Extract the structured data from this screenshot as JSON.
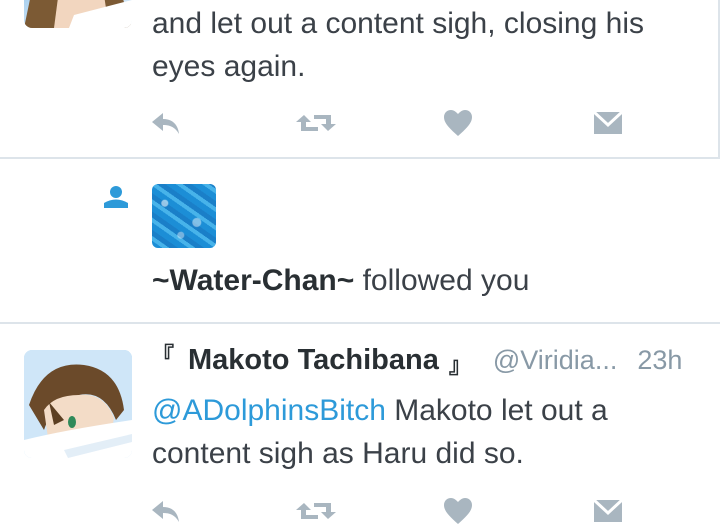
{
  "colors": {
    "accent": "#2d9ad9",
    "icon_gray": "#a9b6c0",
    "text": "#3b4148",
    "muted": "#8899a6",
    "divider": "#dde4ea"
  },
  "tweet_top": {
    "text": "and let out a content sigh, closing his eyes again.",
    "actions": [
      "reply-icon",
      "retweet-icon",
      "like-icon",
      "message-icon"
    ]
  },
  "follow_notification": {
    "icon": "person-icon",
    "name": "~Water-Chan~",
    "action_text": " followed you"
  },
  "tweet_bottom": {
    "quote_open": "『",
    "display_name": "Makoto Tachibana",
    "quote_close": "』",
    "handle": "@Viridia...",
    "time": "23h",
    "mention": "@ADolphinsBitch",
    "text": " Makoto let out a content sigh as Haru did so.",
    "actions": [
      "reply-icon",
      "retweet-icon",
      "like-icon",
      "message-icon"
    ]
  }
}
